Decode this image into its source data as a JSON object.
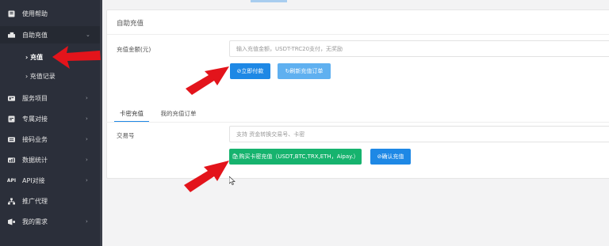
{
  "sidebar": {
    "items": [
      {
        "label": "使用帮助",
        "icon": "help-book-icon"
      },
      {
        "label": "自助充值",
        "icon": "recharge-icon",
        "expanded": true
      },
      {
        "label": "服务项目",
        "icon": "services-icon"
      },
      {
        "label": "专属对接",
        "icon": "docking-icon"
      },
      {
        "label": "接码业务",
        "icon": "sms-code-icon"
      },
      {
        "label": "数据统计",
        "icon": "stats-icon"
      },
      {
        "label": "API对接",
        "icon": "api-icon"
      },
      {
        "label": "推广代理",
        "icon": "promote-icon"
      },
      {
        "label": "我的需求",
        "icon": "my-demand-icon"
      }
    ],
    "sub_items": [
      {
        "label": "› 充值",
        "active": true
      },
      {
        "label": "› 充值记录",
        "active": false
      }
    ]
  },
  "card": {
    "title": "自助充值",
    "amount_label": "充值金额(元)",
    "amount_placeholder": "输入充值金额，USDT-TRC20支付，无奖励",
    "pay_button": "⊘立即付款",
    "refresh_button": "↻刷新充值订单",
    "tabs": [
      "卡密充值",
      "我的充值订单"
    ],
    "tx_label": "交易号",
    "tx_placeholder": "支持 资金转换交易号、卡密",
    "buy_card_button": "🛍购买卡密充值（USDT,BTC,TRX,ETH，Aipay.）",
    "confirm_button": "⊘确认充值"
  },
  "colors": {
    "sidebar_bg": "#2b2f3a",
    "primary_blue": "#1e88e5",
    "light_blue": "#5fb0f0",
    "green": "#16b36e",
    "annotation_red": "#e3141b"
  }
}
